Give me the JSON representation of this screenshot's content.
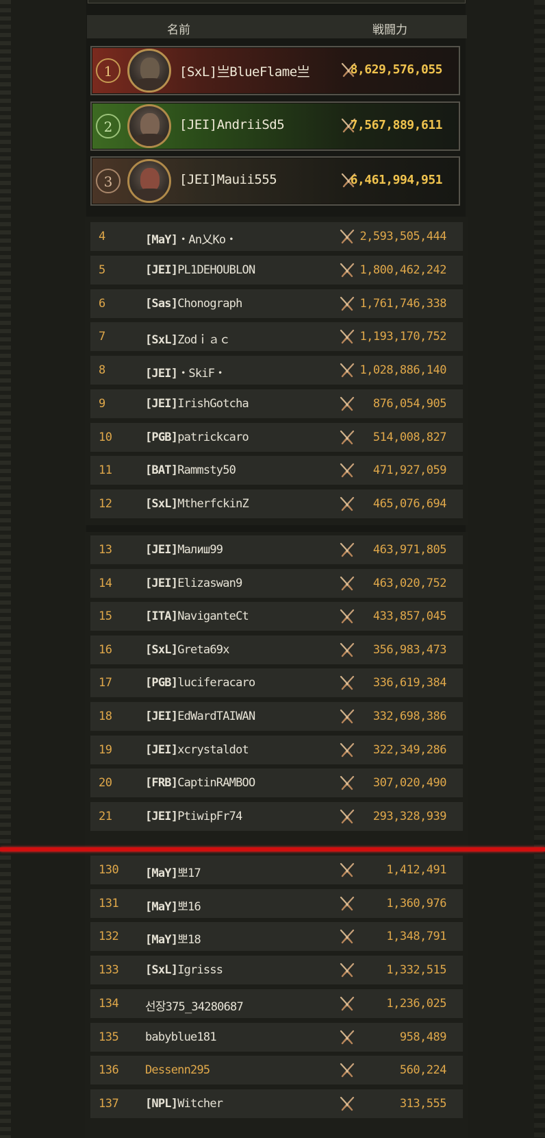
{
  "header": {
    "name_label": "名前",
    "power_label": "戦闘力"
  },
  "icons": {
    "rank_power": "crossed-swords-icon"
  },
  "colors": {
    "rank_gold": "#e0a84a",
    "power_gold": "#f0c34e",
    "separator": "#d10f0f",
    "row_bg": "#2b2c27"
  },
  "top3": [
    {
      "rank": "1",
      "guild": "[SxL]",
      "name": "亗BlueFlame亗",
      "power": "8,629,576,055"
    },
    {
      "rank": "2",
      "guild": "[JEI]",
      "name": "AndriiSd5",
      "power": "7,567,889,611"
    },
    {
      "rank": "3",
      "guild": "[JEI]",
      "name": "Mauii555",
      "power": "6,461,994,951"
    }
  ],
  "rows": [
    {
      "rank": "4",
      "guild": "[MaY]",
      "name": "・An乂Ko・",
      "power": "2,593,505,444"
    },
    {
      "rank": "5",
      "guild": "[JEI]",
      "name": "PL1DEHOUBLON",
      "power": "1,800,462,242"
    },
    {
      "rank": "6",
      "guild": "[Sas]",
      "name": "Chonograph",
      "power": "1,761,746,338"
    },
    {
      "rank": "7",
      "guild": "[SxL]",
      "name": "Zodｉａｃ",
      "power": "1,193,170,752"
    },
    {
      "rank": "8",
      "guild": "[JEI]",
      "name": "・SkiF・",
      "power": "1,028,886,140"
    },
    {
      "rank": "9",
      "guild": "[JEI]",
      "name": "IrishGotcha",
      "power": "876,054,905"
    },
    {
      "rank": "10",
      "guild": "[PGB]",
      "name": "patrickcaro",
      "power": "514,008,827"
    },
    {
      "rank": "11",
      "guild": "[BAT]",
      "name": "Rammsty50",
      "power": "471,927,059"
    },
    {
      "rank": "12",
      "guild": "[SxL]",
      "name": "MtherfckinZ",
      "power": "465,076,694"
    },
    {
      "rank": "13",
      "guild": "[JEI]",
      "name": "Малиш99",
      "power": "463,971,805"
    },
    {
      "rank": "14",
      "guild": "[JEI]",
      "name": "Elizaswan9",
      "power": "463,020,752"
    },
    {
      "rank": "15",
      "guild": "[ITA]",
      "name": "NaviganteCt",
      "power": "433,857,045"
    },
    {
      "rank": "16",
      "guild": "[SxL]",
      "name": "Greta69x",
      "power": "356,983,473"
    },
    {
      "rank": "17",
      "guild": "[PGB]",
      "name": "luciferacaro",
      "power": "336,619,384"
    },
    {
      "rank": "18",
      "guild": "[JEI]",
      "name": "EdWardTAIWAN",
      "power": "332,698,386"
    },
    {
      "rank": "19",
      "guild": "[JEI]",
      "name": "xcrystaldot",
      "power": "322,349,286"
    },
    {
      "rank": "20",
      "guild": "[FRB]",
      "name": "CaptinRAMBOO",
      "power": "307,020,490"
    },
    {
      "rank": "21",
      "guild": "[JEI]",
      "name": "PtiwipFr74",
      "power": "293,328,939"
    },
    {
      "rank": "130",
      "guild": "[MaY]",
      "name": "뽀17",
      "power": "1,412,491"
    },
    {
      "rank": "131",
      "guild": "[MaY]",
      "name": "뽀16",
      "power": "1,360,976"
    },
    {
      "rank": "132",
      "guild": "[MaY]",
      "name": "뽀18",
      "power": "1,348,791"
    },
    {
      "rank": "133",
      "guild": "[SxL]",
      "name": "Igrisss",
      "power": "1,332,515"
    },
    {
      "rank": "134",
      "guild": "",
      "name": "선장375_34280687",
      "power": "1,236,025"
    },
    {
      "rank": "135",
      "guild": "",
      "name": "babyblue181",
      "power": "958,489"
    },
    {
      "rank": "136",
      "guild": "",
      "name": "Dessenn295",
      "power": "560,224"
    },
    {
      "rank": "137",
      "guild": "[NPL]",
      "name": "Witcher",
      "power": "313,555"
    }
  ]
}
